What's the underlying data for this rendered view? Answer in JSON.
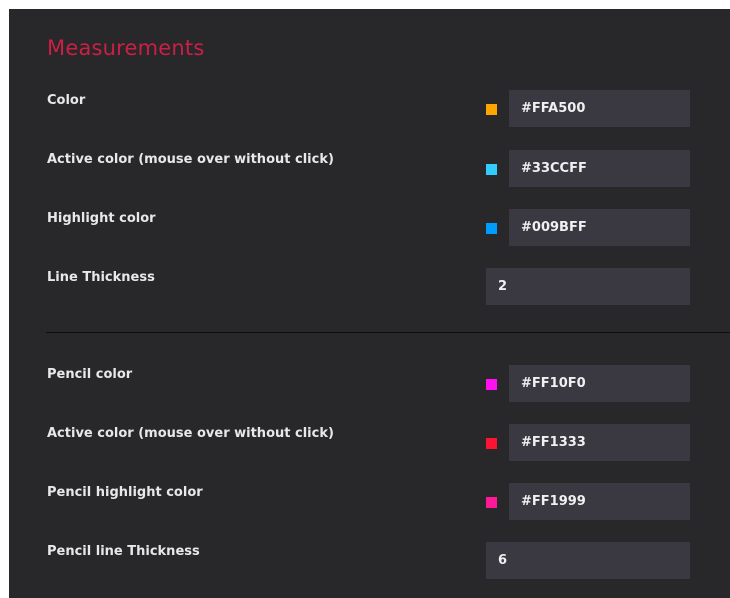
{
  "section": {
    "title": "Measurements"
  },
  "measurement_settings": [
    {
      "label": "Color",
      "value": "#FFA500",
      "swatch": "#FFA500",
      "type": "color"
    },
    {
      "label": "Active color (mouse over without click)",
      "value": "#33CCFF",
      "swatch": "#33CCFF",
      "type": "color"
    },
    {
      "label": "Highlight color",
      "value": "#009BFF",
      "swatch": "#009BFF",
      "type": "color"
    },
    {
      "label": "Line Thickness",
      "value": "2",
      "type": "number"
    }
  ],
  "pencil_settings": [
    {
      "label": "Pencil color",
      "value": "#FF10F0",
      "swatch": "#FF10F0",
      "type": "color"
    },
    {
      "label": "Active color (mouse over without click)",
      "value": "#FF1333",
      "swatch": "#FF1333",
      "type": "color"
    },
    {
      "label": "Pencil highlight color",
      "value": "#FF1999",
      "swatch": "#FF1999",
      "type": "color"
    },
    {
      "label": "Pencil line Thickness",
      "value": "6",
      "type": "number"
    }
  ],
  "colors": {
    "background": "#28272a",
    "title": "#cc1f45",
    "field_background": "#3a3942"
  }
}
